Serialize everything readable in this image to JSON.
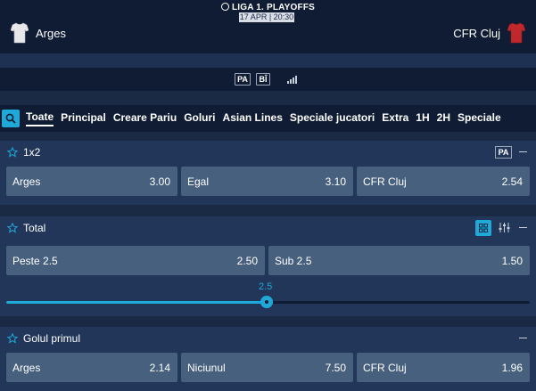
{
  "match": {
    "league": "LIGA 1. PLAYOFFS",
    "datetime": "17 APR | 20:30",
    "home_team": "Arges",
    "away_team": "CFR Cluj"
  },
  "toolbar": {
    "pa_label": "PA",
    "bi_label": "BÎ",
    "signal_icon": "stats-bars-icon"
  },
  "tabs": [
    "Toate",
    "Principal",
    "Creare Pariu",
    "Goluri",
    "Asian Lines",
    "Speciale jucatori",
    "Extra",
    "1H",
    "2H",
    "Speciale"
  ],
  "markets": {
    "m1x2": {
      "title": "1x2",
      "pa_label": "PA",
      "odds": [
        {
          "label": "Arges",
          "value": "3.00"
        },
        {
          "label": "Egal",
          "value": "3.10"
        },
        {
          "label": "CFR Cluj",
          "value": "2.54"
        }
      ]
    },
    "total": {
      "title": "Total",
      "odds": [
        {
          "label": "Peste 2.5",
          "value": "2.50"
        },
        {
          "label": "Sub 2.5",
          "value": "1.50"
        }
      ],
      "slider_value": "2.5"
    },
    "first_goal": {
      "title": "Golul primul",
      "odds": [
        {
          "label": "Arges",
          "value": "2.14"
        },
        {
          "label": "Niciunul",
          "value": "7.50"
        },
        {
          "label": "CFR Cluj",
          "value": "1.96"
        }
      ]
    }
  },
  "colors": {
    "accent": "#1fa9d9",
    "background": "#1a2a45",
    "panel": "#22365a",
    "odd_button": "#46607e",
    "home_jersey": "#e8e8ea",
    "away_jersey": "#c0282d"
  }
}
